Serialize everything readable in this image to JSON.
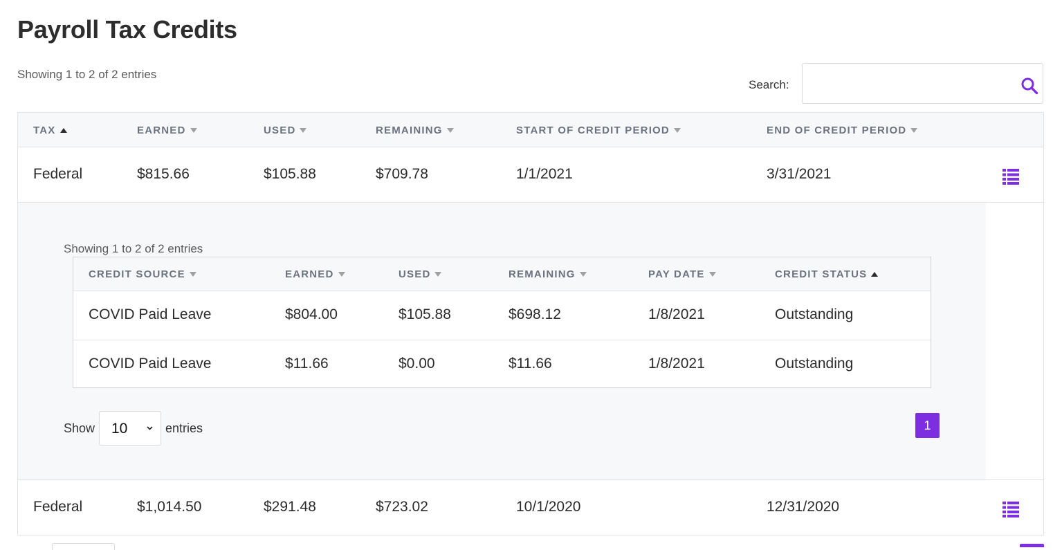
{
  "page": {
    "title": "Payroll Tax Credits",
    "info": "Showing 1 to 2 of 2 entries"
  },
  "search": {
    "label": "Search:",
    "value": "",
    "placeholder": ""
  },
  "colors": {
    "accent": "#7c2ee0",
    "header_bg": "#f7f8fa"
  },
  "table": {
    "columns": [
      {
        "label": "TAX",
        "sort": "asc"
      },
      {
        "label": "EARNED",
        "sort": "none"
      },
      {
        "label": "USED",
        "sort": "none"
      },
      {
        "label": "REMAINING",
        "sort": "none"
      },
      {
        "label": "START OF CREDIT PERIOD",
        "sort": "none"
      },
      {
        "label": "END OF CREDIT PERIOD",
        "sort": "none"
      }
    ],
    "rows": [
      {
        "tax": "Federal",
        "earned": "$815.66",
        "used": "$105.88",
        "remaining": "$709.78",
        "start": "1/1/2021",
        "end": "3/31/2021",
        "action_icon": "list-icon"
      },
      {
        "tax": "Federal",
        "earned": "$1,014.50",
        "used": "$291.48",
        "remaining": "$723.02",
        "start": "10/1/2020",
        "end": "12/31/2020",
        "action_icon": "list-icon"
      }
    ]
  },
  "subtable": {
    "info": "Showing 1 to 2 of 2 entries",
    "columns": [
      {
        "label": "CREDIT SOURCE",
        "sort": "none"
      },
      {
        "label": "EARNED",
        "sort": "none"
      },
      {
        "label": "USED",
        "sort": "none"
      },
      {
        "label": "REMAINING",
        "sort": "none"
      },
      {
        "label": "PAY DATE",
        "sort": "none"
      },
      {
        "label": "CREDIT STATUS",
        "sort": "asc"
      }
    ],
    "rows": [
      {
        "source": "COVID Paid Leave",
        "earned": "$804.00",
        "used": "$105.88",
        "remaining": "$698.12",
        "pay_date": "1/8/2021",
        "status": "Outstanding"
      },
      {
        "source": "COVID Paid Leave",
        "earned": "$11.66",
        "used": "$0.00",
        "remaining": "$11.66",
        "pay_date": "1/8/2021",
        "status": "Outstanding"
      }
    ],
    "length": {
      "show_label": "Show",
      "value": "10",
      "entries_label": "entries"
    },
    "pagination": {
      "current": "1"
    }
  }
}
